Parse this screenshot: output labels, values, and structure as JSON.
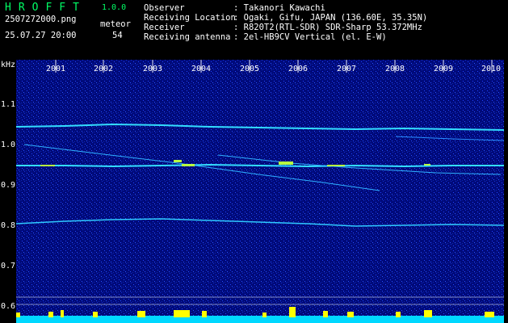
{
  "app": {
    "name": "HROFFT",
    "version": "1.0.0"
  },
  "file": {
    "name": "2507272000.png",
    "datetime": "25.07.27 20:00"
  },
  "meteor": {
    "label": "meteor",
    "count": "54"
  },
  "info": [
    {
      "key": "Observer",
      "value": ": Takanori Kawachi"
    },
    {
      "key": "Receiving Location",
      "value": ": Ogaki, Gifu, JAPAN (136.60E, 35.35N)"
    },
    {
      "key": "Receiver",
      "value": ": R820T2(RTL-SDR) SDR-Sharp 53.372MHz"
    },
    {
      "key": "Receiving antenna",
      "value": ": 2el-HB9CV Vertical (el. E-W)"
    }
  ],
  "axis": {
    "unit": "kHz",
    "x_ticks": [
      "2001",
      "2002",
      "2003",
      "2004",
      "2005",
      "2006",
      "2007",
      "2008",
      "2009",
      "2010"
    ],
    "y_ticks": [
      "1.1",
      "1.0",
      "0.9",
      "0.8",
      "0.7",
      "0.6"
    ]
  },
  "colors": {
    "background": "#000a7a",
    "noise": "#1a3cff",
    "trace": "#00e5ff",
    "meteor": "#ffff00",
    "title": "#00ff66"
  }
}
